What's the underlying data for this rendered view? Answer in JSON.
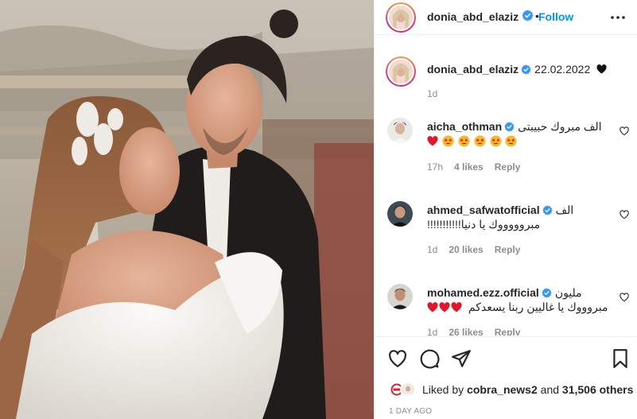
{
  "post": {
    "author": "donia_abd_elaziz",
    "follow_label": "Follow",
    "dot": "•",
    "caption_text": "22.02.2022",
    "caption_time": "1d"
  },
  "comments": [
    {
      "username": "aicha_othman",
      "text": "الف مبروك حبيبتى",
      "emoji_line": [
        "heart",
        "star-eyes",
        "star-eyes",
        "star-eyes",
        "star-eyes",
        "star-eyes"
      ],
      "time": "17h",
      "likes": "4 likes",
      "reply": "Reply"
    },
    {
      "username": "ahmed_safwatofficial",
      "text": "الف",
      "line2": "مبروووووك يا دنيا!!!!!!!!!!!",
      "time": "1d",
      "likes": "20 likes",
      "reply": "Reply"
    },
    {
      "username": "mohamed.ezz.official",
      "text": "مليون",
      "line2": "مبروووك يا غاليين ربنا يسعدكم",
      "line2_emoji": [
        "heart",
        "heart",
        "heart"
      ],
      "time": "1d",
      "likes": "26 likes",
      "reply": "Reply"
    }
  ],
  "footer": {
    "liked_by_prefix": "Liked by",
    "liked_by_user": "cobra_news2",
    "liked_by_and": "and",
    "liked_by_count": "31,506 others",
    "timestamp": "1 DAY AGO"
  },
  "icons": {
    "more": "more-icon",
    "verified": "verified-badge-icon",
    "like": "heart-outline-icon",
    "comment": "comment-icon",
    "share": "share-icon",
    "save": "bookmark-icon"
  },
  "colors": {
    "link_blue": "#0095f6",
    "verified_blue": "#3897f0",
    "muted": "#8e8e8e",
    "text": "#262626",
    "heart_red": "#e0182d"
  }
}
